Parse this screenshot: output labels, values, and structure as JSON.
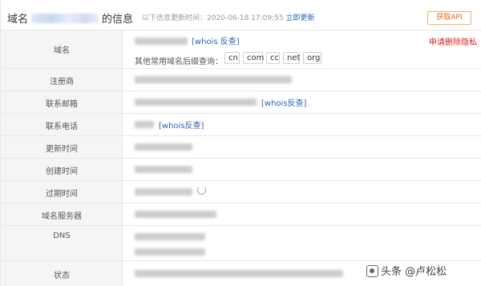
{
  "header": {
    "title_prefix": "域名",
    "title_suffix": "的信息",
    "update_text": "以下信息更新时间：2020-06-18 17:09:55",
    "refresh_label": "立即更新",
    "api_label": "获取API"
  },
  "rows": {
    "domain": {
      "label": "域名",
      "whois_link": "[whois 反查]",
      "suffix_query_label": "其他常用域名后缀查询：",
      "suffixes": [
        "cn",
        "com",
        "cc",
        "net",
        "org"
      ],
      "privacy_link": "申请删除隐私"
    },
    "registrar": {
      "label": "注册商"
    },
    "email": {
      "label": "联系邮箱",
      "whois_link": "[whois反查]"
    },
    "phone": {
      "label": "联系电话",
      "whois_link": "[whois反查]"
    },
    "updated": {
      "label": "更新时间"
    },
    "created": {
      "label": "创建时间"
    },
    "expires": {
      "label": "过期时间"
    },
    "nameserver": {
      "label": "域名服务器"
    },
    "dns": {
      "label": "DNS"
    },
    "status": {
      "label": "状态"
    }
  },
  "watermark": {
    "text": "头条 @卢松松"
  }
}
